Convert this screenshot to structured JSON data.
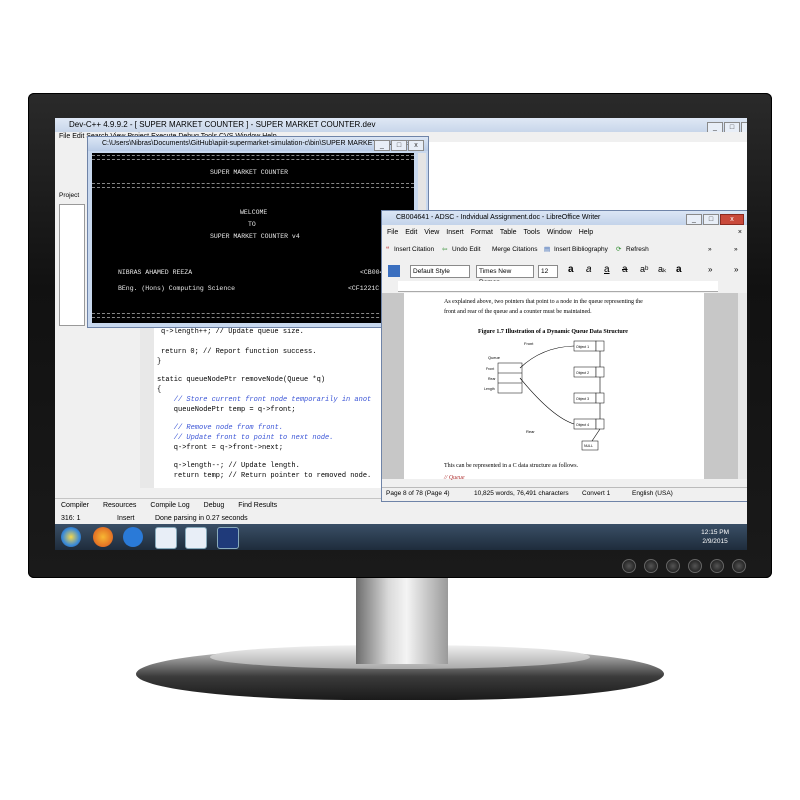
{
  "devcpp": {
    "title": "Dev-C++ 4.9.9.2  - [ SUPER MARKET COUNTER ] - SUPER MARKET COUNTER.dev",
    "menu": "File  Edit  Search  View  Project  Execute  Debug  Tools  CVS  Window  Help",
    "project_tab": "Project",
    "code_lines": [
      "q->length++; // Update queue size.",
      "",
      "return 0; // Report function success.",
      "}",
      "",
      "static queueNodePtr removeNode(Queue *q)",
      "{",
      "    // Store current front node temporarily in anot",
      "    queueNodePtr temp = q->front;",
      "",
      "    // Remove node from front.",
      "    // Update front to point to next node.",
      "    q->front = q->front->next;",
      "",
      "    q->length--; // Update length.",
      "    return temp; // Return pointer to removed node.",
      "}"
    ],
    "bottom_tabs": [
      "Compiler",
      "Resources",
      "Compile Log",
      "Debug",
      "Find Results"
    ],
    "status": {
      "position": "316: 1",
      "mode": "Insert",
      "message": "Done parsing in 0.27 seconds"
    }
  },
  "console": {
    "title": "C:\\Users\\Nibras\\Documents\\GitHub\\apiit-supermarket-simulation-c\\bin\\SUPER MARKET COUNTER...",
    "lines": {
      "header": "SUPER MARKET COUNTER",
      "welcome": "WELCOME",
      "to": "TO",
      "app": "SUPER MARKET COUNTER v4",
      "author": "NIBRAS AHAMED REEZA",
      "id1": "<CB0046",
      "degree": "BEng. (Hons) Computing Science",
      "id2": "<CF1221C"
    }
  },
  "writer": {
    "title": "CB004641 - ADSC - Indvidual Assignment.doc - LibreOffice Writer",
    "menu": [
      "File",
      "Edit",
      "View",
      "Insert",
      "Format",
      "Table",
      "Tools",
      "Window",
      "Help"
    ],
    "toolbar": {
      "insert_citation": "Insert Citation",
      "undo_edit": "Undo Edit",
      "merge_citations": "Merge Citations",
      "insert_bibliography": "Insert Bibliography",
      "refresh": "Refresh"
    },
    "style": "Default Style",
    "font": "Times New Roman",
    "size": "12",
    "doc": {
      "para1a": "As explained above, two pointers that point to a node in the queue representing the",
      "para1b": "front and rear of the queue and a counter must be maintained.",
      "figure_caption": "Figure 1.7 Illustration of a Dynamic Queue Data Structure",
      "para2": "This can be represented in a C data structure as follows.",
      "code_start": "// Queue",
      "diagram": {
        "front": "Front",
        "rear": "Rear",
        "queue": "Queue",
        "front_f": "Front",
        "rear_f": "Rear",
        "length": "Length",
        "o1": "Object 1",
        "o2": "Object 2",
        "o3": "Object 3",
        "o4": "Object 4",
        "null": "NULL"
      }
    },
    "status": {
      "page": "Page 8 of 78 (Page 4)",
      "words": "10,825 words, 76,491 characters",
      "convert": "Convert 1",
      "lang": "English (USA)"
    }
  },
  "taskbar": {
    "time": "12:15 PM",
    "date": "2/9/2015"
  }
}
